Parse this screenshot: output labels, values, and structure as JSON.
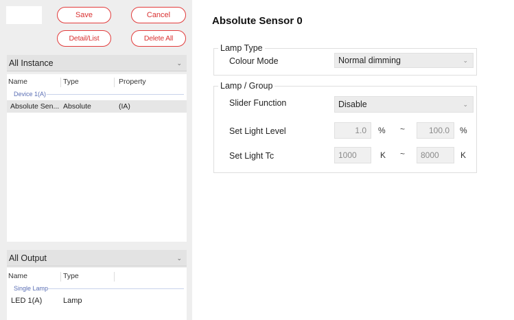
{
  "toolbar": {
    "save_label": "Save",
    "cancel_label": "Cancel",
    "detail_list_label": "Detail/List",
    "delete_all_label": "Delete All"
  },
  "instances": {
    "dropdown_value": "All Instance",
    "columns": [
      "Name",
      "Type",
      "Property"
    ],
    "group_label": "Device 1(A)",
    "rows": [
      {
        "name": "Absolute Sen...",
        "type": "Absolute",
        "property": "(IA)"
      }
    ]
  },
  "outputs": {
    "dropdown_value": "All Output",
    "columns": [
      "Name",
      "Type"
    ],
    "group_label": "Single Lamp",
    "rows": [
      {
        "name": "LED 1(A)",
        "type": "Lamp"
      }
    ]
  },
  "detail": {
    "title": "Absolute Sensor 0",
    "lamp_type": {
      "legend": "Lamp Type",
      "colour_mode_label": "Colour Mode",
      "colour_mode_value": "Normal dimming"
    },
    "lamp_group": {
      "legend": "Lamp / Group",
      "slider_function_label": "Slider Function",
      "slider_function_value": "Disable",
      "light_level_label": "Set Light Level",
      "light_level_min": "1.0",
      "light_level_max": "100.0",
      "light_level_unit": "%",
      "light_tc_label": "Set Light Tc",
      "light_tc_min": "1000",
      "light_tc_max": "8000",
      "light_tc_unit": "K",
      "range_separator": "~"
    }
  }
}
